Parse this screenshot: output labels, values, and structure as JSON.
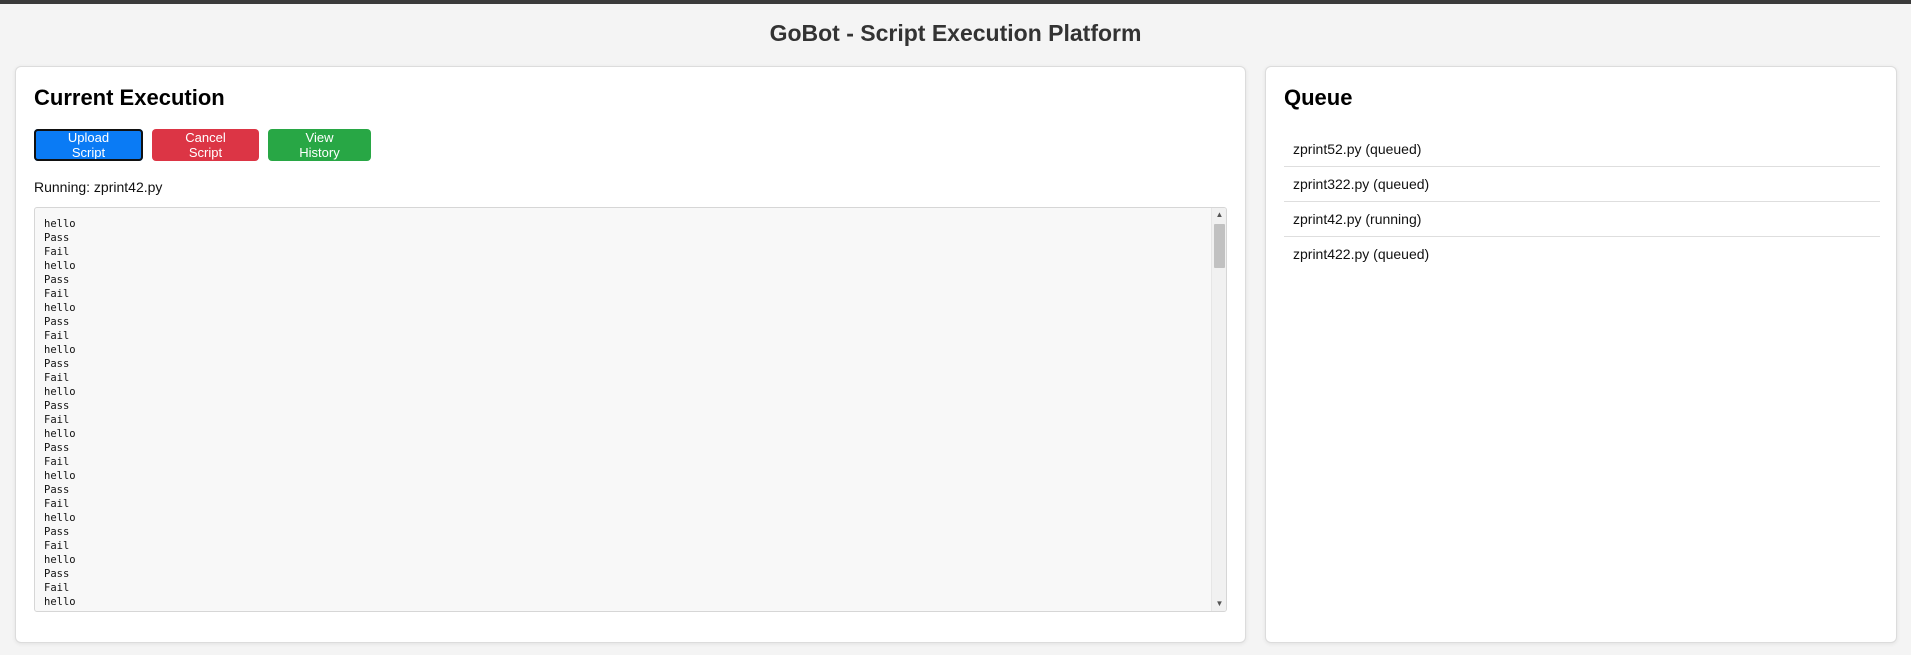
{
  "app": {
    "title": "GoBot - Script Execution Platform"
  },
  "current_execution": {
    "heading": "Current Execution",
    "buttons": {
      "upload": "Upload Script",
      "cancel": "Cancel Script",
      "history": "View History"
    },
    "running_text": "Running: zprint42.py",
    "output_lines": [
      "hello",
      "Pass",
      "Fail",
      "hello",
      "Pass",
      "Fail",
      "hello",
      "Pass",
      "Fail",
      "hello",
      "Pass",
      "Fail",
      "hello",
      "Pass",
      "Fail",
      "hello",
      "Pass",
      "Fail",
      "hello",
      "Pass",
      "Fail",
      "hello",
      "Pass",
      "Fail",
      "hello",
      "Pass",
      "Fail",
      "hello"
    ]
  },
  "queue": {
    "heading": "Queue",
    "items": [
      "zprint52.py (queued)",
      "zprint322.py (queued)",
      "zprint42.py (running)",
      "zprint422.py (queued)"
    ]
  },
  "colors": {
    "upload_button": "#0a7bf5",
    "cancel_button": "#dc3545",
    "history_button": "#28a745"
  },
  "icons": {
    "scroll_up": "scroll-up-arrow-icon",
    "scroll_down": "scroll-down-arrow-icon"
  }
}
